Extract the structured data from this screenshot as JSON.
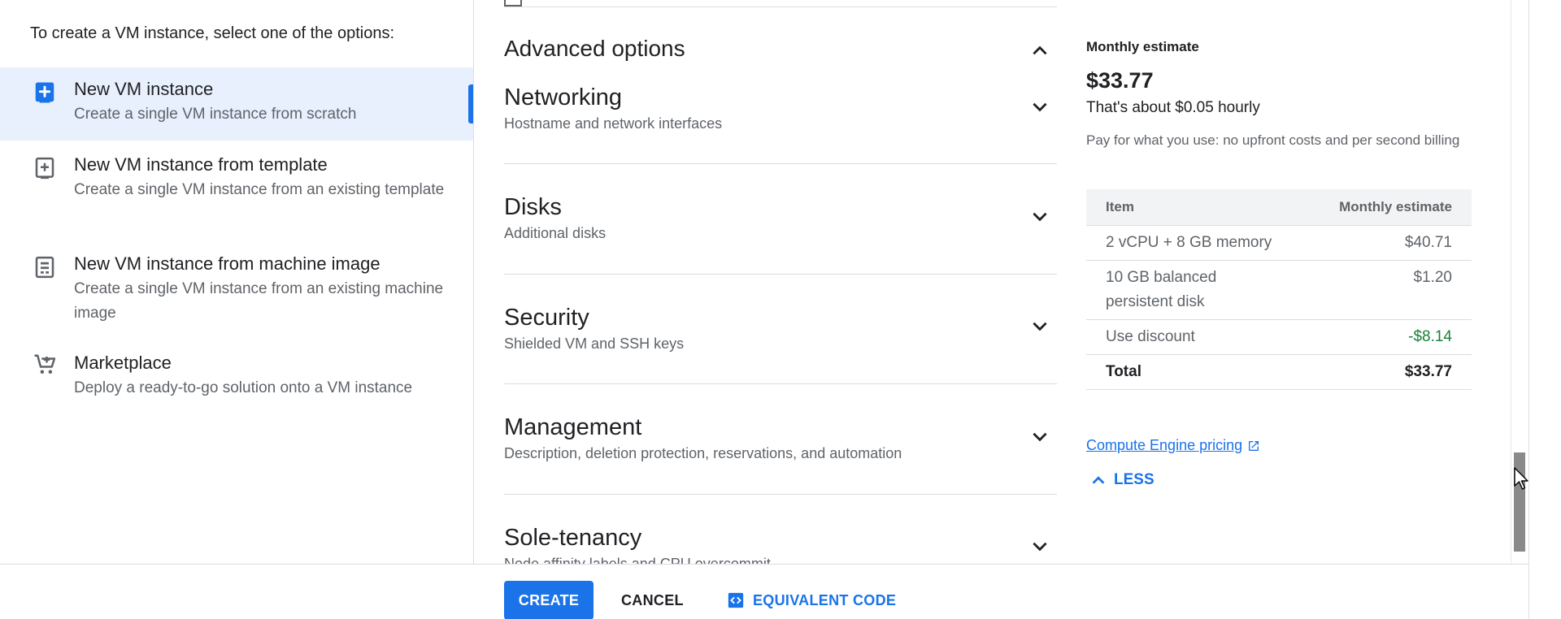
{
  "intro": "To create a VM instance, select one of the options:",
  "options": [
    {
      "title": "New VM instance",
      "desc": "Create a single VM instance from scratch",
      "icon": "add-box-icon",
      "selected": true
    },
    {
      "title": "New VM instance from template",
      "desc": "Create a single VM instance from an existing template",
      "icon": "add-template-icon"
    },
    {
      "title": "New VM instance from machine image",
      "desc": "Create a single VM instance from an existing machine image",
      "icon": "machine-image-icon"
    },
    {
      "title": "Marketplace",
      "desc": "Deploy a ready-to-go solution onto a VM instance",
      "icon": "cart-icon"
    }
  ],
  "advanced": {
    "title": "Advanced options",
    "expanded": true
  },
  "sections": [
    {
      "title": "Networking",
      "desc": "Hostname and network interfaces"
    },
    {
      "title": "Disks",
      "desc": "Additional disks"
    },
    {
      "title": "Security",
      "desc": "Shielded VM and SSH keys"
    },
    {
      "title": "Management",
      "desc": "Description, deletion protection, reservations, and automation"
    },
    {
      "title": "Sole-tenancy",
      "desc": "Node affinity labels and CPU overcommit"
    }
  ],
  "estimate": {
    "label": "Monthly estimate",
    "price": "$33.77",
    "hourly": "That's about $0.05 hourly",
    "note": "Pay for what you use: no upfront costs and per second billing",
    "headers": {
      "item": "Item",
      "amount": "Monthly estimate"
    },
    "rows": [
      {
        "item": "2 vCPU + 8 GB memory",
        "amount": "$40.71"
      },
      {
        "item": "10 GB balanced persistent disk",
        "amount": "$1.20"
      },
      {
        "item": "Use discount",
        "amount": "-$8.14"
      },
      {
        "item": "Total",
        "amount": "$33.77"
      }
    ],
    "pricing_link": "Compute Engine pricing",
    "less_label": "LESS"
  },
  "footer": {
    "create": "CREATE",
    "cancel": "CANCEL",
    "code": "EQUIVALENT CODE"
  },
  "colors": {
    "accent": "#1a73e8",
    "selected_bg": "#e8f0fe",
    "discount": "#188038"
  }
}
